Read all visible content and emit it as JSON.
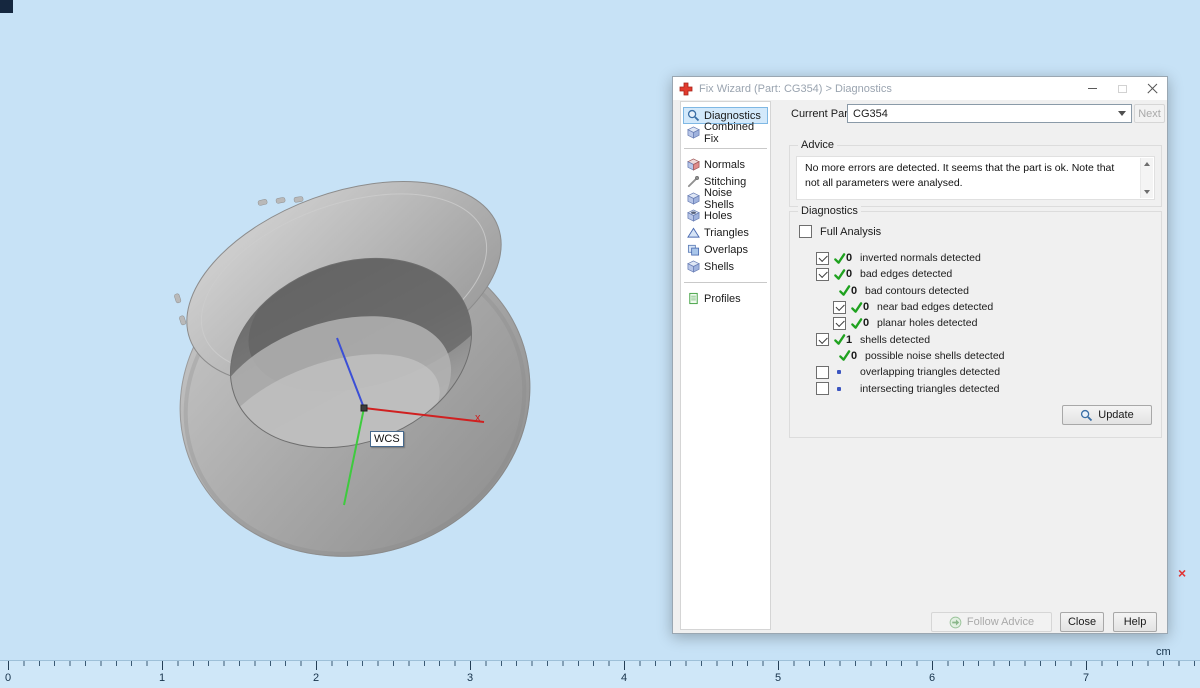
{
  "viewport": {
    "wcs_label": "WCS",
    "axis_x_label": "x",
    "red_x": "×"
  },
  "ruler": {
    "unit": "cm",
    "labels": [
      "0",
      "1",
      "2",
      "3",
      "4",
      "5",
      "6",
      "7"
    ]
  },
  "dialog": {
    "title": "Fix Wizard (Part: CG354) > Diagnostics",
    "current_part": {
      "label": "Current Part:",
      "value": "CG354",
      "next_label": "Next"
    },
    "sidebar": {
      "items": [
        {
          "label": "Diagnostics",
          "icon": "magnifier-icon",
          "selected": true
        },
        {
          "label": "Combined Fix",
          "icon": "cube-icon",
          "selected": false
        },
        {
          "label": "Normals",
          "icon": "cube-red-icon",
          "selected": false
        },
        {
          "label": "Stitching",
          "icon": "needle-icon",
          "selected": false
        },
        {
          "label": "Noise Shells",
          "icon": "cube-icon",
          "selected": false
        },
        {
          "label": "Holes",
          "icon": "cube-hole-icon",
          "selected": false
        },
        {
          "label": "Triangles",
          "icon": "triangle-icon",
          "selected": false
        },
        {
          "label": "Overlaps",
          "icon": "overlap-icon",
          "selected": false
        },
        {
          "label": "Shells",
          "icon": "cube-icon",
          "selected": false
        },
        {
          "label": "Profiles",
          "icon": "document-icon",
          "selected": false
        }
      ]
    },
    "advice": {
      "group_label": "Advice",
      "text": "No more errors are detected. It seems that the part is ok. Note that not all parameters were analysed."
    },
    "diagnostics": {
      "group_label": "Diagnostics",
      "full_analysis_label": "Full Analysis",
      "rows": [
        {
          "checkbox": true,
          "checked": true,
          "status": "ok",
          "count": "0",
          "label": "inverted normals detected"
        },
        {
          "checkbox": true,
          "checked": true,
          "status": "ok",
          "count": "0",
          "label": "bad edges detected"
        },
        {
          "checkbox": false,
          "checked": false,
          "status": "ok",
          "count": "0",
          "label": "bad contours detected"
        },
        {
          "checkbox": true,
          "checked": true,
          "status": "ok",
          "count": "0",
          "label": "near bad edges detected"
        },
        {
          "checkbox": true,
          "checked": true,
          "status": "ok",
          "count": "0",
          "label": "planar holes detected"
        },
        {
          "checkbox": true,
          "checked": true,
          "status": "ok",
          "count": "1",
          "label": "shells detected"
        },
        {
          "checkbox": false,
          "checked": false,
          "status": "ok",
          "count": "0",
          "label": "possible noise shells detected"
        },
        {
          "checkbox": true,
          "checked": false,
          "status": "none",
          "count": "",
          "label": "overlapping triangles detected"
        },
        {
          "checkbox": true,
          "checked": false,
          "status": "none",
          "count": "",
          "label": "intersecting triangles detected"
        }
      ],
      "update_label": "Update"
    },
    "footer": {
      "follow_advice_label": "Follow Advice",
      "close_label": "Close",
      "help_label": "Help"
    }
  },
  "colors": {
    "background": "#c7e2f6",
    "check_green": "#1fa21f",
    "axis_x": "#d02020",
    "axis_y": "#3ecb3e",
    "axis_z": "#3b4fd6"
  },
  "icons": {
    "fix-wizard-icon": "red cross",
    "minimize-icon": "minimize dash",
    "maximize-icon": "maximize square",
    "close-icon": "close x",
    "dropdown-arrow-icon": "down triangle",
    "magnifier-icon": "magnifying glass",
    "cube-icon": "blue cube",
    "cube-red-icon": "cube with red face",
    "needle-icon": "stitching needle",
    "cube-hole-icon": "cube with hole",
    "triangle-icon": "triangle",
    "overlap-icon": "overlapping squares",
    "document-icon": "green document",
    "check-ok-icon": "green check mark",
    "pending-dot-icon": "blue dot",
    "scroll-up-icon": "scrollbar up arrow",
    "scroll-down-icon": "scrollbar down arrow",
    "follow-advice-arrow-icon": "green arrow"
  }
}
